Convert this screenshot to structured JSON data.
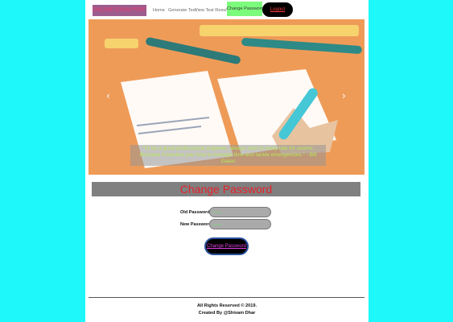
{
  "navbar": {
    "brand": "ONLINE EXAM PORTAL",
    "links": [
      "Home",
      "Generate Test",
      "View Test Results"
    ],
    "active": "Change Password",
    "logout": "Logout"
  },
  "carousel": {
    "prev": "‹",
    "next": "›",
    "caption": "\"To be a good professional engineer, always start to study late for exams. Because it teaches you how to manage time and tackle emergencies.\" - Bill Gates"
  },
  "form": {
    "title": "Change Password",
    "old_label": "Old Password:",
    "old_value": "••••••••",
    "new_label": "New Password:",
    "new_value": "••••••••",
    "submit": "Change Password"
  },
  "footer": {
    "rights": "All Rights Reserved © 2019.",
    "credit": "Created By @Shivam Dhar"
  }
}
